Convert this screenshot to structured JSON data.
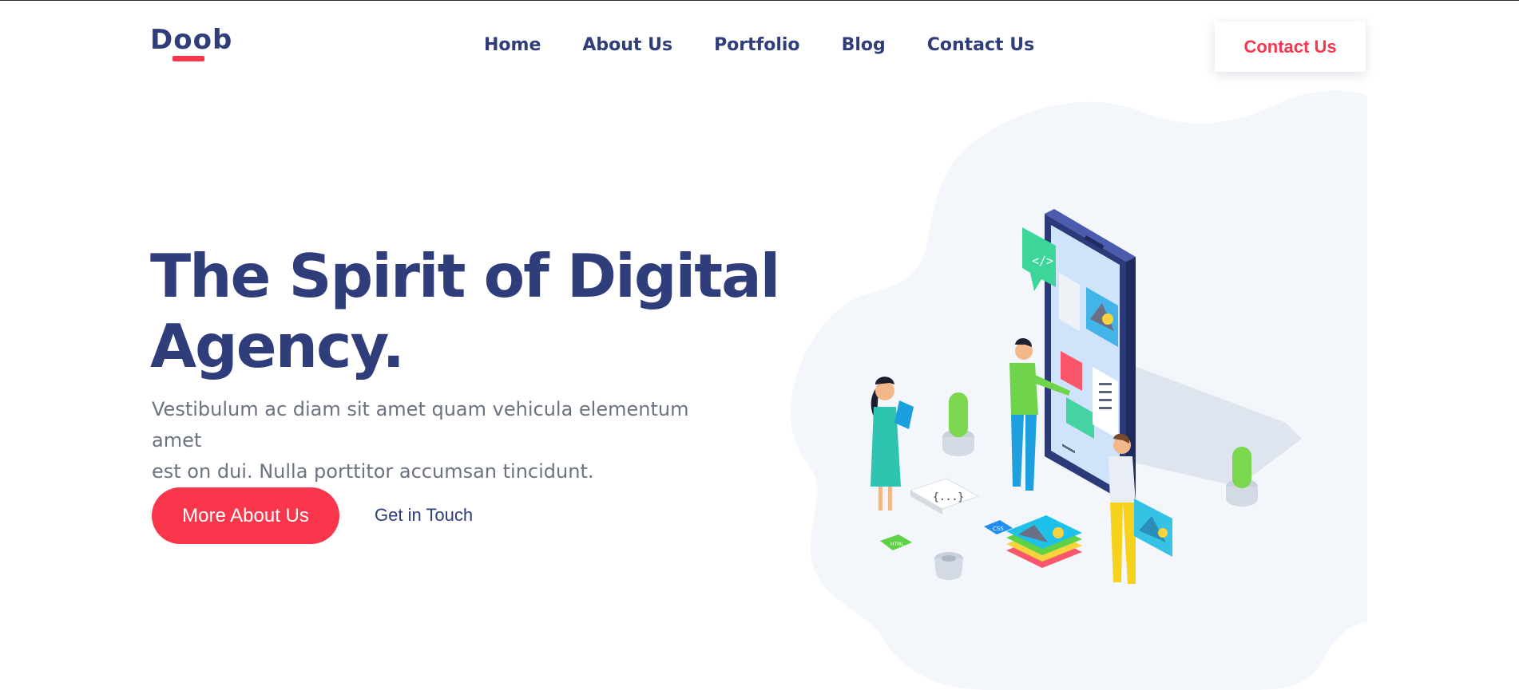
{
  "header": {
    "logo_text": "Doob",
    "nav": [
      "Home",
      "About Us",
      "Portfolio",
      "Blog",
      "Contact Us"
    ],
    "cta_label": "Contact Us"
  },
  "hero": {
    "title_line1": "The Spirit of Digital",
    "title_line2": "Agency.",
    "subtitle_line1": "Vestibulum ac diam sit amet quam vehicula elementum amet",
    "subtitle_line2": "est on dui. Nulla porttitor accumsan tincidunt.",
    "primary_button": "More About Us",
    "secondary_link": "Get in Touch",
    "illustration": {
      "code_badge": "</>",
      "braces_badge": "{...}",
      "css_badge": "CSS",
      "html_badge": "HTML"
    }
  },
  "colors": {
    "brand_navy": "#2f3d7b",
    "accent_red": "#f9364c",
    "text_muted": "#6b7280",
    "blob_bg": "#f3f7fc"
  },
  "icons": [
    "logo-underline-mark",
    "code-icon",
    "image-icon",
    "plant-icon",
    "phone-mockup"
  ]
}
